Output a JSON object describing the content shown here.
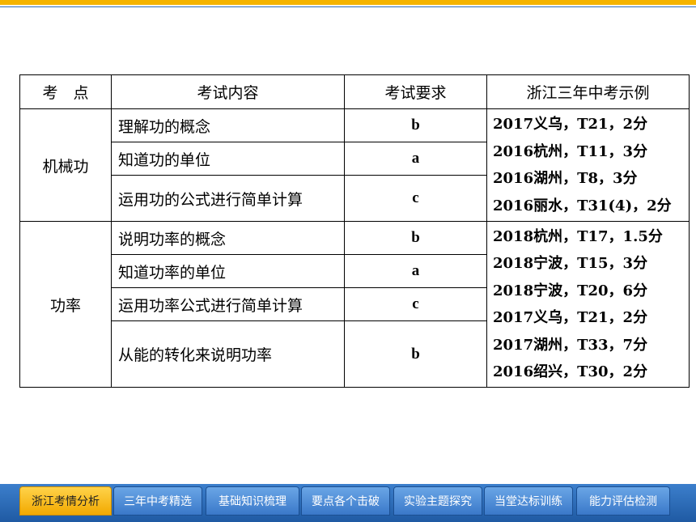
{
  "table": {
    "headers": [
      "考　点",
      "考试内容",
      "考试要求",
      "浙江三年中考示例"
    ],
    "sections": [
      {
        "point": "机械功",
        "rows": [
          {
            "content": "理解功的概念",
            "req": "b"
          },
          {
            "content": "知道功的单位",
            "req": "a"
          },
          {
            "content": "运用功的公式进行简单计算",
            "req": "c"
          }
        ],
        "examples": [
          "2017义乌，T21，2分",
          "2016杭州，T11，3分",
          "2016湖州，T8，3分",
          "2016丽水，T31(4)，2分"
        ]
      },
      {
        "point": "功率",
        "rows": [
          {
            "content": "说明功率的概念",
            "req": "b"
          },
          {
            "content": "知道功率的单位",
            "req": "a"
          },
          {
            "content": "运用功率公式进行简单计算",
            "req": "c"
          },
          {
            "content": "从能的转化来说明功率",
            "req": "b"
          }
        ],
        "examples": [
          "2018杭州，T17，1.5分",
          "2018宁波，T15，3分",
          "2018宁波，T20，6分",
          "2017义乌，T21，2分",
          "2017湖州，T33，7分",
          "2016绍兴，T30，2分"
        ]
      }
    ]
  },
  "nav": {
    "tabs": [
      "浙江考情分析",
      "三年中考精选",
      "基础知识梳理",
      "要点各个击破",
      "实验主题探究",
      "当堂达标训练",
      "能力评估检测"
    ],
    "active_index": 0,
    "accent_color": "#f5b400",
    "bar_color": "#2f6db5"
  }
}
